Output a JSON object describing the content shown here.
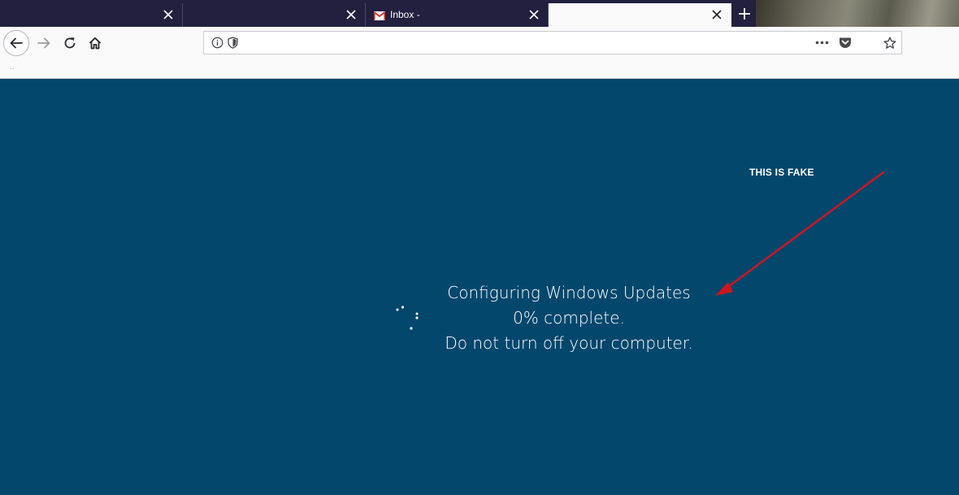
{
  "browser": {
    "tabs": [
      {
        "title": "",
        "favicon": null,
        "active": false
      },
      {
        "title": "",
        "favicon": null,
        "active": false
      },
      {
        "title": "Inbox -",
        "favicon": "gmail-icon",
        "active": false
      },
      {
        "title": "",
        "favicon": null,
        "active": true
      }
    ],
    "new_tab_icon": "plus-icon",
    "nav_icons": [
      "back-icon",
      "forward-icon",
      "reload-icon",
      "home-icon"
    ],
    "url": {
      "value": "",
      "left_icons": [
        "info-icon",
        "tracking-shield-icon"
      ],
      "right_icons": [
        "page-actions-icon",
        "pocket-icon",
        "bookmark-star-icon"
      ]
    }
  },
  "page": {
    "background": "#04476d",
    "annotation": {
      "text": "THIS IS FAKE",
      "arrow_color": "#d0151d"
    },
    "update_message": {
      "line1": "Configuring Windows Updates",
      "line2": "0% complete.",
      "line3": "Do not turn off your computer."
    },
    "spinner_icon": "loading-dots-icon"
  }
}
